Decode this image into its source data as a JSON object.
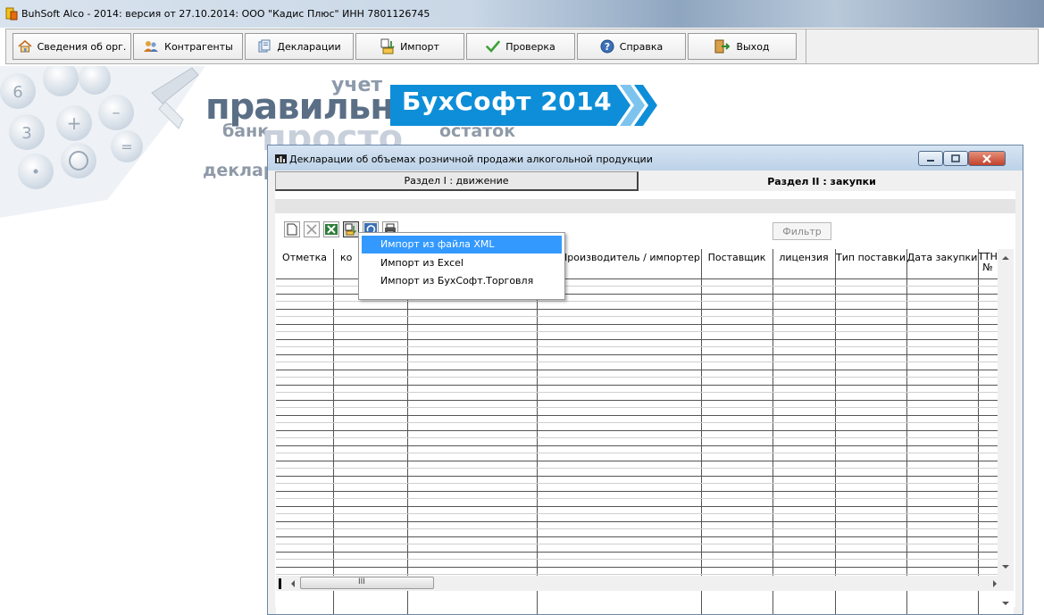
{
  "window": {
    "title": "BuhSoft Alco - 2014: версия от 27.10.2014: ООО \"Кадис Плюс\" ИНН 7801126745"
  },
  "toolbar": {
    "buttons": [
      {
        "label": "Сведения об орг.",
        "icon": "house-icon"
      },
      {
        "label": "Контрагенты",
        "icon": "users-icon"
      },
      {
        "label": "Декларации",
        "icon": "document-icon"
      },
      {
        "label": "Импорт",
        "icon": "import-icon"
      },
      {
        "label": "Проверка",
        "icon": "checkmark-icon"
      },
      {
        "label": "Справка",
        "icon": "help-icon"
      },
      {
        "label": "Выход",
        "icon": "exit-icon"
      }
    ]
  },
  "banner": {
    "word_big": "правильно",
    "word_uchet": "учет",
    "word_bank": "банк",
    "word_prosto": "просто",
    "word_ostatok": "остаток",
    "word_deklara": "деклара",
    "brand": "БухСофт 2014",
    "brand_color": "#0e8ed8"
  },
  "dialog": {
    "title": "Декларации об объемах розничной продажи алкогольной продукции",
    "section1": "Раздел I : движение",
    "section2": "Раздел II : закупки",
    "filter_label": "Фильтр",
    "columns": [
      "Отметка",
      "ко",
      "",
      "Производитель / импортер",
      "Поставщик",
      "лицензия",
      "Тип поставки",
      "Дата закупки",
      "ТТН №"
    ],
    "scroll_marker": "III"
  },
  "context_menu": {
    "items": [
      "Импорт из файла XML",
      "Импорт из Excel",
      "Импорт из БухСофт.Торговля"
    ],
    "selected_index": 0,
    "selection_color": "#3399ff"
  }
}
